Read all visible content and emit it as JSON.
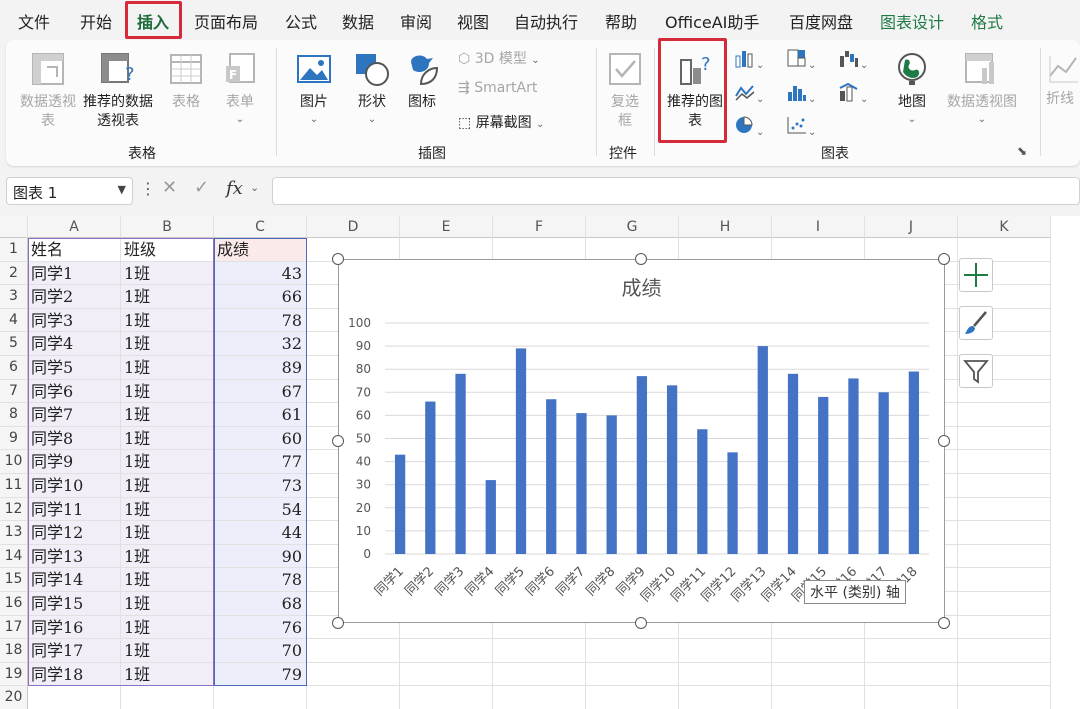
{
  "menu": {
    "tabs": [
      "文件",
      "开始",
      "插入",
      "页面布局",
      "公式",
      "数据",
      "审阅",
      "视图",
      "自动执行",
      "帮助",
      "OfficeAI助手",
      "百度网盘",
      "图表设计",
      "格式"
    ],
    "active": "插入"
  },
  "ribbon": {
    "tables": {
      "pivot_table": "数据透视表",
      "recommended_pivot": "推荐的数据透视表",
      "table": "表格",
      "form": "表单",
      "group_label": "表格"
    },
    "illustrations": {
      "pictures": "图片",
      "shapes": "形状",
      "icons": "图标",
      "models_3d": "3D 模型",
      "smartart": "SmartArt",
      "screenshot": "屏幕截图",
      "group_label": "插图"
    },
    "controls": {
      "checkbox": "复选框",
      "group_label": "控件"
    },
    "charts": {
      "recommended": "推荐的图表",
      "map": "地图",
      "pivot_chart": "数据透视图",
      "group_label": "图表"
    },
    "sparklines": {
      "line": "折线"
    }
  },
  "formula_bar": {
    "name_box": "图表 1",
    "fx": "fx",
    "formula": ""
  },
  "grid": {
    "columns": [
      "A",
      "B",
      "C",
      "D",
      "E",
      "F",
      "G",
      "H",
      "I",
      "J",
      "K"
    ],
    "header_row": [
      "姓名",
      "班级",
      "成绩"
    ],
    "rows": [
      [
        "同学1",
        "1班",
        "43"
      ],
      [
        "同学2",
        "1班",
        "66"
      ],
      [
        "同学3",
        "1班",
        "78"
      ],
      [
        "同学4",
        "1班",
        "32"
      ],
      [
        "同学5",
        "1班",
        "89"
      ],
      [
        "同学6",
        "1班",
        "67"
      ],
      [
        "同学7",
        "1班",
        "61"
      ],
      [
        "同学8",
        "1班",
        "60"
      ],
      [
        "同学9",
        "1班",
        "77"
      ],
      [
        "同学10",
        "1班",
        "73"
      ],
      [
        "同学11",
        "1班",
        "54"
      ],
      [
        "同学12",
        "1班",
        "44"
      ],
      [
        "同学13",
        "1班",
        "90"
      ],
      [
        "同学14",
        "1班",
        "78"
      ],
      [
        "同学15",
        "1班",
        "68"
      ],
      [
        "同学16",
        "1班",
        "76"
      ],
      [
        "同学17",
        "1班",
        "70"
      ],
      [
        "同学18",
        "1班",
        "79"
      ]
    ]
  },
  "chart_data": {
    "type": "bar",
    "title": "成绩",
    "categories": [
      "同学1",
      "同学2",
      "同学3",
      "同学4",
      "同学5",
      "同学6",
      "同学7",
      "同学8",
      "同学9",
      "同学10",
      "同学11",
      "同学12",
      "同学13",
      "同学14",
      "同学15",
      "同学16",
      "同学17",
      "同学18"
    ],
    "values": [
      43,
      66,
      78,
      32,
      89,
      67,
      61,
      60,
      77,
      73,
      54,
      44,
      90,
      78,
      68,
      76,
      70,
      79
    ],
    "ylim": [
      0,
      100
    ],
    "yticks": [
      0,
      10,
      20,
      30,
      40,
      50,
      60,
      70,
      80,
      90,
      100
    ],
    "grid": true,
    "color": "#4472c4"
  },
  "tooltip": "水平 (类别) 轴",
  "colors": {
    "accent_green": "#1e7b45",
    "highlight_red": "#d42a3a",
    "bar_blue": "#4472c4"
  }
}
